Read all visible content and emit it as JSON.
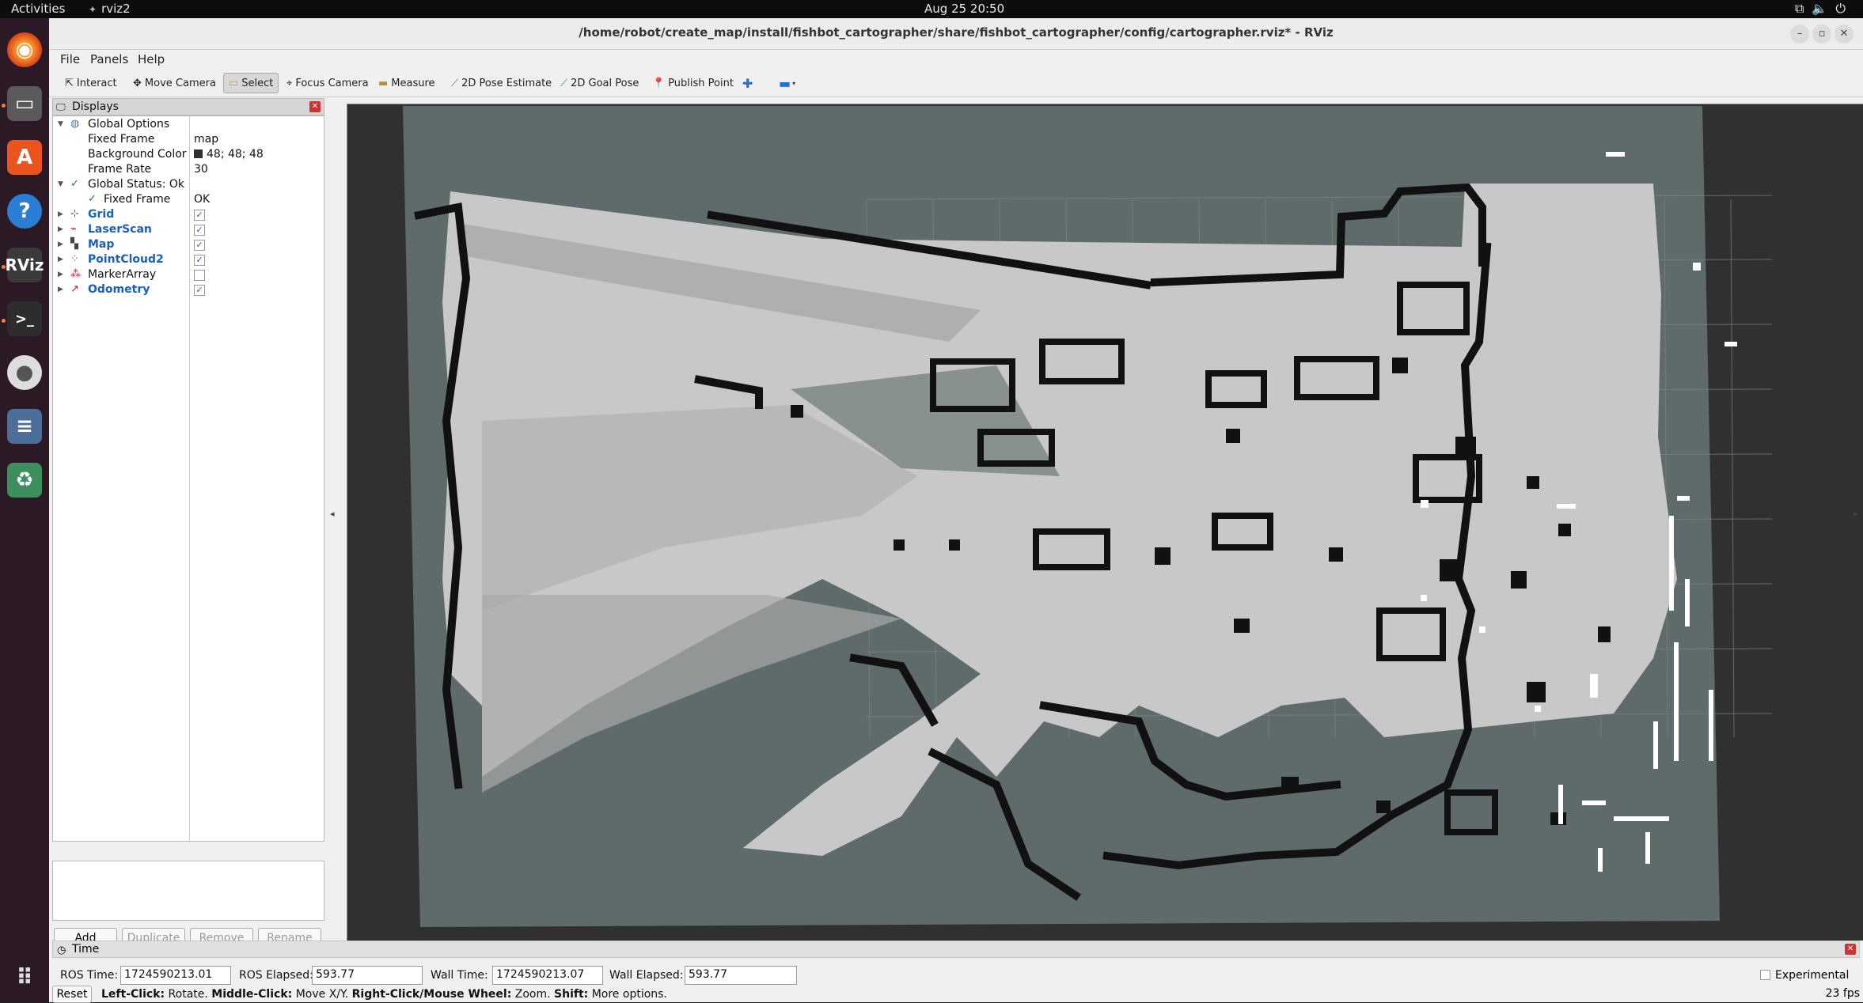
{
  "topbar": {
    "activities": "Activities",
    "app_name": "rviz2",
    "clock": "Aug 25  20:50"
  },
  "window": {
    "title": "/home/robot/create_map/install/fishbot_cartographer/share/fishbot_cartographer/config/cartographer.rviz* - RViz"
  },
  "menu": [
    "File",
    "Panels",
    "Help"
  ],
  "toolbar": {
    "interact": "Interact",
    "move_camera": "Move Camera",
    "select": "Select",
    "focus_camera": "Focus Camera",
    "measure": "Measure",
    "pose_estimate": "2D Pose Estimate",
    "goal_pose": "2D Goal Pose",
    "publish_point": "Publish Point"
  },
  "displays": {
    "title": "Displays",
    "global_options": "Global Options",
    "fixed_frame_label": "Fixed Frame",
    "fixed_frame_value": "map",
    "background_color_label": "Background Color",
    "background_color_value": "48; 48; 48",
    "frame_rate_label": "Frame Rate",
    "frame_rate_value": "30",
    "global_status": "Global Status: Ok",
    "status_fixed_frame_label": "Fixed Frame",
    "status_fixed_frame_value": "OK",
    "items": [
      {
        "name": "Grid",
        "checked": true
      },
      {
        "name": "LaserScan",
        "checked": true
      },
      {
        "name": "Map",
        "checked": true
      },
      {
        "name": "PointCloud2",
        "checked": true
      },
      {
        "name": "MarkerArray",
        "checked": false
      },
      {
        "name": "Odometry",
        "checked": true
      }
    ],
    "buttons": {
      "add": "Add",
      "duplicate": "Duplicate",
      "remove": "Remove",
      "rename": "Rename"
    }
  },
  "time": {
    "title": "Time",
    "ros_time_label": "ROS Time:",
    "ros_time": "1724590213.01",
    "ros_elapsed_label": "ROS Elapsed:",
    "ros_elapsed": "593.77",
    "wall_time_label": "Wall Time:",
    "wall_time": "1724590213.07",
    "wall_elapsed_label": "Wall Elapsed:",
    "wall_elapsed": "593.77",
    "experimental": "Experimental"
  },
  "status": {
    "reset": "Reset",
    "hint_1": "Left-Click:",
    "hint_1_text": " Rotate. ",
    "hint_2": "Middle-Click:",
    "hint_2_text": " Move X/Y. ",
    "hint_3": "Right-Click/Mouse Wheel:",
    "hint_3_text": " Zoom. ",
    "hint_4": "Shift:",
    "hint_4_text": " More options.",
    "fps": "23 fps"
  },
  "colors": {
    "viewport_background": "#303030",
    "unknown_area": "#5f6b6b",
    "free_space": "#c7c7c7",
    "obstacle": "#111111",
    "dock": "#2b1a25"
  }
}
